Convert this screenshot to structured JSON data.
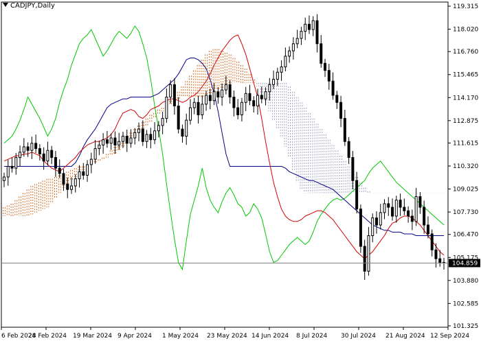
{
  "window": {
    "symbol_title": "CADJPY,Daily"
  },
  "chart_data": {
    "type": "candlestick",
    "title": "CADJPY,Daily",
    "y_ticks": [
      "119.315",
      "118.020",
      "116.760",
      "115.465",
      "114.170",
      "112.875",
      "111.615",
      "110.320",
      "109.025",
      "107.730",
      "106.470",
      "105.175",
      "103.880",
      "102.585",
      "101.325"
    ],
    "x_ticks": [
      "6 Feb 2024",
      "28 Feb 2024",
      "19 Mar 2024",
      "9 Apr 2024",
      "1 May 2024",
      "23 May 2024",
      "14 Jun 2024",
      "8 Jul 2024",
      "30 Jul 2024",
      "21 Aug 2024",
      "12 Sep 2024"
    ],
    "ylim": [
      101.325,
      119.315
    ],
    "current_price": "104.859",
    "colors": {
      "candle": "#000000",
      "tenkan": "#d40000",
      "kijun": "#00008b",
      "chikou": "#00c800",
      "cloud_upper": "#d2691e",
      "cloud_lower": "#a0a0c0",
      "price_line": "#808080"
    },
    "series": {
      "close": [
        109.7,
        110.3,
        110.2,
        110.8,
        111.1,
        111.4,
        111.2,
        111.6,
        111.3,
        111.0,
        110.6,
        111.2,
        110.8,
        110.2,
        109.9,
        109.3,
        109.0,
        109.2,
        109.6,
        110.0,
        109.8,
        110.4,
        110.7,
        111.3,
        111.5,
        111.8,
        111.6,
        111.9,
        111.5,
        111.7,
        112.0,
        111.6,
        111.9,
        112.2,
        112.4,
        111.7,
        112.1,
        111.8,
        112.3,
        112.6,
        113.0,
        114.2,
        114.9,
        113.7,
        112.4,
        112.0,
        112.9,
        113.6,
        113.9,
        113.2,
        113.8,
        114.3,
        114.0,
        114.5,
        114.2,
        114.6,
        114.9,
        114.2,
        113.6,
        113.2,
        113.9,
        114.4,
        114.0,
        113.7,
        114.3,
        114.1,
        114.5,
        114.9,
        115.2,
        115.6,
        115.9,
        116.5,
        116.8,
        117.2,
        117.5,
        117.9,
        118.3,
        118.0,
        118.5,
        117.2,
        116.1,
        115.7,
        115.1,
        114.3,
        113.9,
        113.0,
        111.7,
        110.8,
        109.5,
        107.9,
        105.8,
        104.4,
        106.4,
        107.4,
        107.0,
        107.7,
        108.2,
        108.0,
        107.5,
        108.4,
        108.0,
        107.8,
        107.5,
        107.2,
        108.6,
        108.0,
        107.0,
        106.5,
        105.6,
        105.1,
        104.9,
        104.86
      ],
      "tenkan": [
        110.6,
        110.7,
        110.8,
        110.9,
        110.9,
        111.0,
        111.0,
        111.1,
        111.0,
        110.9,
        110.6,
        110.4,
        110.2,
        110.1,
        110.0,
        110.2,
        110.4,
        110.6,
        110.8,
        111.1,
        111.3,
        111.5,
        111.6,
        111.7,
        111.7,
        111.8,
        111.9,
        112.1,
        112.4,
        112.9,
        113.3,
        113.4,
        113.5,
        113.4,
        113.1,
        113.0,
        113.2,
        113.5,
        113.6,
        113.7,
        113.9,
        114.0,
        114.1,
        114.1,
        114.0,
        113.9,
        114.0,
        114.2,
        114.3,
        114.5,
        114.8,
        115.1,
        115.5,
        116.0,
        116.4,
        116.8,
        117.1,
        117.4,
        117.6,
        117.7,
        117.2,
        116.6,
        115.8,
        115.0,
        114.2,
        113.0,
        111.7,
        110.5,
        109.4,
        108.6,
        107.9,
        107.5,
        107.3,
        107.2,
        107.2,
        107.3,
        107.5,
        107.6,
        107.7,
        107.8,
        107.8,
        107.7,
        107.5,
        107.3,
        107.0,
        106.7,
        106.4,
        106.1,
        105.8,
        105.5,
        105.3,
        105.1,
        105.3,
        105.5,
        105.8,
        106.1,
        106.4,
        106.8,
        107.1,
        107.2,
        107.4,
        107.5,
        107.5,
        107.4,
        107.2,
        107.0,
        106.7,
        106.4,
        106.1,
        105.8,
        105.5,
        105.3
      ],
      "kijun": [
        110.3,
        110.3,
        110.3,
        110.3,
        110.3,
        110.3,
        110.3,
        110.3,
        110.3,
        110.3,
        110.3,
        110.3,
        110.3,
        110.3,
        110.3,
        110.3,
        110.3,
        110.3,
        110.5,
        110.9,
        111.4,
        111.8,
        112.1,
        112.4,
        112.8,
        113.2,
        113.6,
        113.8,
        113.9,
        114.0,
        114.1,
        114.1,
        114.2,
        114.2,
        114.2,
        114.2,
        114.2,
        114.2,
        114.3,
        114.4,
        114.6,
        114.8,
        115.0,
        115.2,
        115.5,
        115.9,
        116.3,
        116.4,
        116.4,
        116.3,
        116.1,
        115.8,
        115.2,
        114.4,
        113.4,
        112.2,
        111.0,
        110.3,
        110.3,
        110.3,
        110.3,
        110.3,
        110.3,
        110.3,
        110.3,
        110.3,
        110.3,
        110.3,
        110.3,
        110.3,
        110.3,
        110.2,
        110.0,
        109.9,
        109.8,
        109.7,
        109.6,
        109.5,
        109.5,
        109.4,
        109.3,
        109.2,
        109.1,
        109.0,
        108.8,
        108.6,
        108.4,
        108.2,
        108.0,
        107.8,
        107.6,
        107.4,
        107.2,
        107.0,
        106.9,
        106.8,
        106.7,
        106.7,
        106.6,
        106.6,
        106.6,
        106.5,
        106.5,
        106.5,
        106.4,
        106.4,
        106.4,
        106.4,
        106.4,
        106.4,
        106.4,
        106.4
      ],
      "chikou": [
        111.6,
        111.8,
        112.0,
        112.4,
        112.9,
        113.5,
        114.2,
        113.8,
        113.4,
        113.0,
        112.5,
        112.0,
        112.4,
        113.0,
        113.9,
        114.6,
        115.2,
        116.0,
        116.6,
        117.2,
        117.5,
        117.7,
        118.0,
        117.5,
        117.0,
        116.5,
        116.8,
        117.2,
        117.6,
        117.9,
        117.7,
        117.5,
        117.8,
        118.2,
        117.9,
        117.2,
        116.4,
        115.2,
        113.7,
        112.4,
        111.0,
        109.3,
        107.7,
        106.2,
        104.9,
        104.5,
        106.1,
        107.6,
        108.4,
        109.2,
        110.2,
        109.1,
        108.4,
        108.0,
        107.7,
        108.3,
        108.8,
        109.1,
        108.7,
        108.2,
        108.0,
        107.5,
        107.7,
        108.2,
        107.9,
        107.4,
        106.5,
        105.5,
        104.9,
        105.0,
        105.3,
        105.6,
        105.9,
        106.1,
        106.3,
        106.1,
        105.9,
        106.1,
        106.6,
        107.2,
        107.6,
        107.9,
        108.2,
        108.4,
        108.5,
        108.4,
        108.5,
        108.7,
        108.9,
        109.1,
        109.3,
        109.5,
        109.9,
        110.2,
        110.4,
        110.6,
        110.3,
        110.0,
        109.7,
        109.4,
        109.2,
        109.0,
        108.8,
        108.6,
        108.4,
        108.2,
        108.0,
        107.8,
        107.6,
        107.4,
        107.2,
        107.0
      ],
      "cloud_a": [
        108.0,
        108.1,
        108.2,
        108.4,
        108.6,
        108.8,
        109.0,
        109.2,
        109.3,
        109.4,
        109.5,
        109.6,
        109.6,
        109.7,
        109.8,
        109.9,
        110.0,
        110.1,
        110.2,
        110.3,
        110.3,
        110.4,
        110.5,
        110.6,
        110.7,
        110.8,
        111.0,
        111.2,
        111.4,
        111.6,
        111.8,
        112.0,
        112.2,
        112.4,
        112.6,
        112.8,
        113.0,
        113.2,
        113.3,
        113.5,
        113.6,
        113.8,
        114.0,
        114.2,
        114.5,
        114.8,
        115.1,
        115.4,
        115.7,
        116.0,
        116.3,
        116.6,
        116.8,
        116.9,
        116.9,
        116.8,
        116.7,
        116.6,
        116.4,
        116.2,
        116.0,
        115.8,
        115.5,
        115.2,
        114.8,
        114.4,
        113.9,
        113.4,
        112.9,
        112.4,
        111.9,
        111.4,
        110.8,
        110.1,
        109.4,
        109.0,
        108.8,
        108.8,
        108.8,
        108.8,
        108.8,
        108.8,
        108.8,
        108.8,
        108.8,
        108.8,
        108.8,
        108.8,
        108.8,
        108.8,
        108.8,
        108.8,
        108.8,
        108.8,
        108.8,
        108.8,
        108.8,
        108.8,
        108.8,
        108.8,
        108.8,
        108.8,
        108.8,
        108.8,
        108.8,
        108.8,
        108.8,
        108.8,
        108.8,
        108.8,
        108.8,
        108.8
      ],
      "cloud_b": [
        107.5,
        107.5,
        107.5,
        107.5,
        107.5,
        107.5,
        107.5,
        107.6,
        107.7,
        107.8,
        107.9,
        108.0,
        108.2,
        108.5,
        108.8,
        109.1,
        109.3,
        109.5,
        109.7,
        109.9,
        110.1,
        110.3,
        110.4,
        110.5,
        110.6,
        110.7,
        110.8,
        110.9,
        111.0,
        111.2,
        111.4,
        111.6,
        111.8,
        112.0,
        112.2,
        112.4,
        112.6,
        112.8,
        113.0,
        113.2,
        113.4,
        113.6,
        113.8,
        114.0,
        114.1,
        114.2,
        114.2,
        114.2,
        114.2,
        114.2,
        114.2,
        114.3,
        114.4,
        114.5,
        114.6,
        114.7,
        114.8,
        114.9,
        115.0,
        115.0,
        115.0,
        115.0,
        115.0,
        115.0,
        115.0,
        115.0,
        115.0,
        115.0,
        115.0,
        115.0,
        115.0,
        115.0,
        114.8,
        114.5,
        114.2,
        113.9,
        113.6,
        113.3,
        113.0,
        112.7,
        112.4,
        112.1,
        111.8,
        111.5,
        111.2,
        110.9,
        110.6,
        110.3,
        110.0,
        109.7,
        109.4,
        109.1,
        108.9,
        108.8,
        108.8,
        108.8,
        108.8,
        108.8,
        108.8,
        108.8,
        108.8,
        108.8,
        108.8,
        108.8,
        108.8,
        108.8,
        108.8,
        108.8,
        108.8,
        108.8,
        108.8,
        108.8
      ]
    }
  }
}
